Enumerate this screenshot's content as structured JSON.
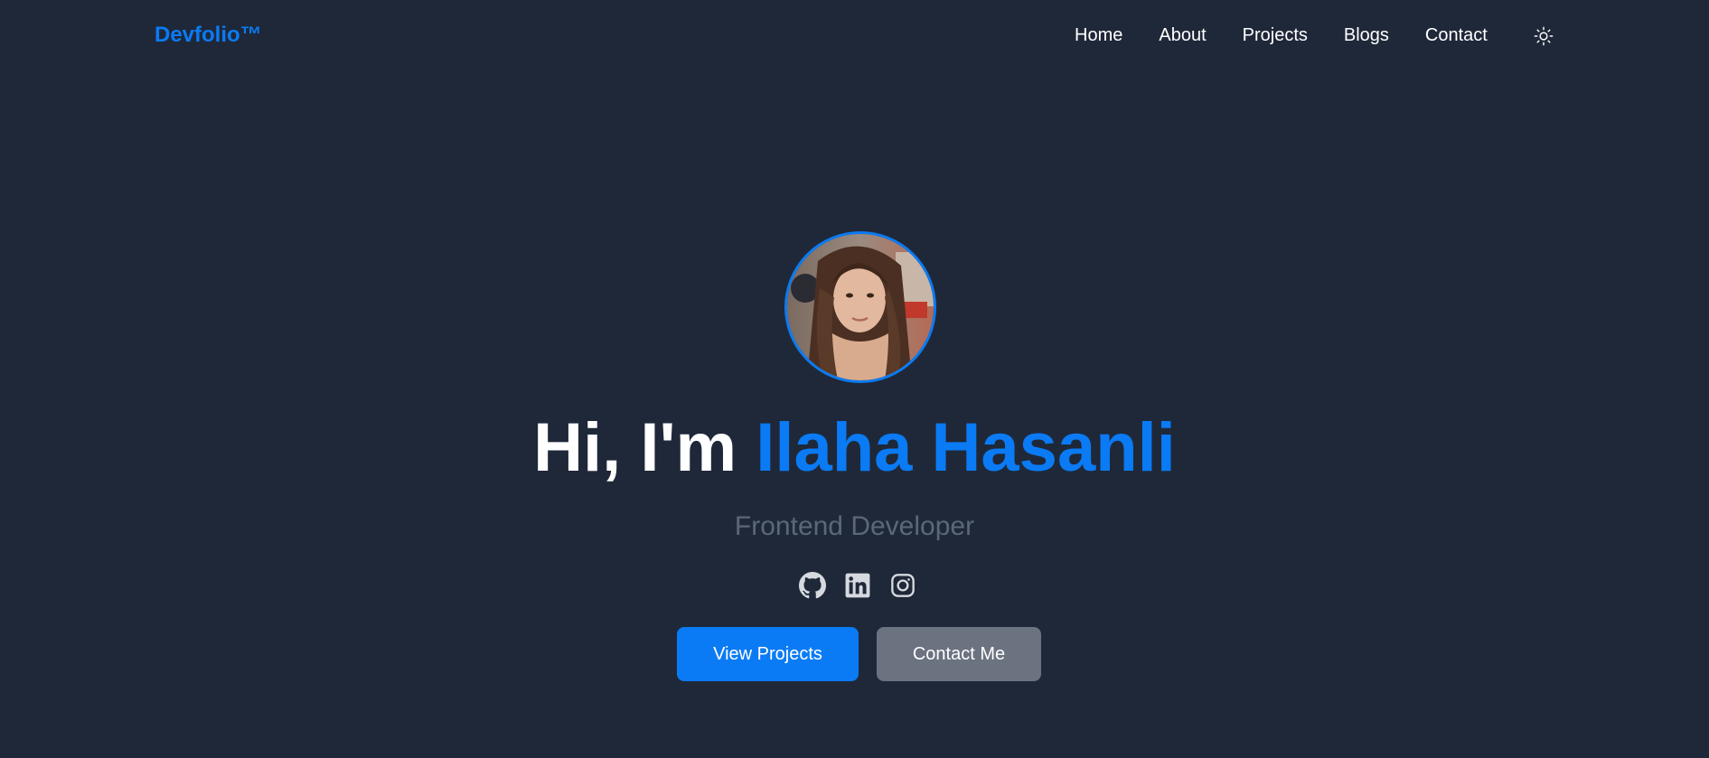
{
  "header": {
    "brand": "Devfolio™",
    "nav": [
      {
        "label": "Home"
      },
      {
        "label": "About"
      },
      {
        "label": "Projects"
      },
      {
        "label": "Blogs"
      },
      {
        "label": "Contact"
      }
    ],
    "theme_icon": "sun-icon"
  },
  "hero": {
    "greeting": "Hi, I'm ",
    "name": "Ilaha Hasanli",
    "subtitle": "Frontend Developer",
    "socials": [
      {
        "icon": "github-icon"
      },
      {
        "icon": "linkedin-icon"
      },
      {
        "icon": "instagram-icon"
      }
    ],
    "primary_button": "View Projects",
    "secondary_button": "Contact Me"
  },
  "colors": {
    "background": "#1f2839",
    "accent": "#0a7bf4",
    "muted_text": "#5c6777",
    "secondary_button": "#6b7280"
  }
}
